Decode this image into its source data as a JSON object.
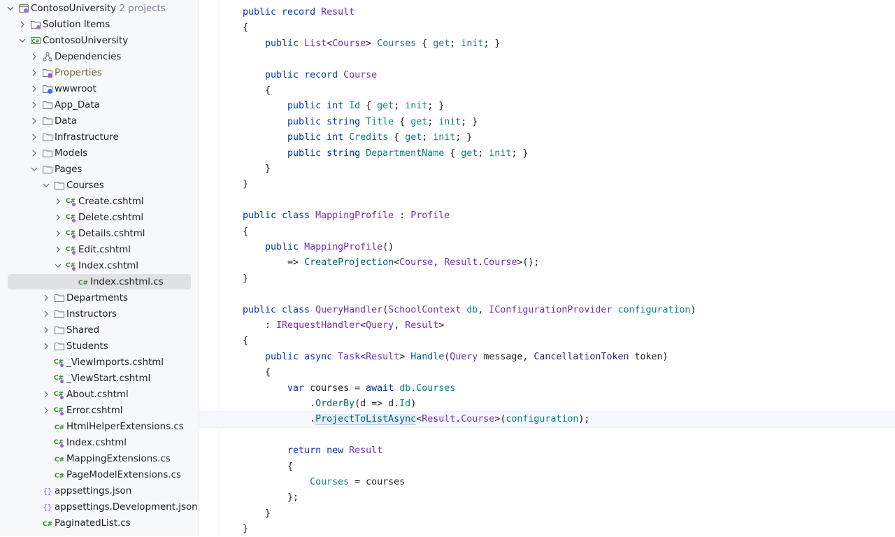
{
  "solution": {
    "name": "ContosoUniversity",
    "count": "· 2 projects"
  },
  "tree": [
    {
      "label": "Solution Items",
      "icon": "folder-solution-icon",
      "depth": 1,
      "expanded": false
    },
    {
      "label": "ContosoUniversity",
      "icon": "csharp-project-icon",
      "depth": 1,
      "expanded": true
    },
    {
      "label": "Dependencies",
      "icon": "dependencies-icon",
      "depth": 2,
      "expanded": false
    },
    {
      "label": "Properties",
      "icon": "properties-folder-icon",
      "depth": 2,
      "expanded": false,
      "style": "olive"
    },
    {
      "label": "wwwroot",
      "icon": "web-folder-icon",
      "depth": 2,
      "expanded": false
    },
    {
      "label": "App_Data",
      "icon": "folder-icon",
      "depth": 2,
      "expanded": false
    },
    {
      "label": "Data",
      "icon": "folder-icon",
      "depth": 2,
      "expanded": false
    },
    {
      "label": "Infrastructure",
      "icon": "folder-icon",
      "depth": 2,
      "expanded": false
    },
    {
      "label": "Models",
      "icon": "folder-icon",
      "depth": 2,
      "expanded": false
    },
    {
      "label": "Pages",
      "icon": "folder-icon",
      "depth": 2,
      "expanded": true
    },
    {
      "label": "Courses",
      "icon": "folder-icon",
      "depth": 3,
      "expanded": true
    },
    {
      "label": "Create.cshtml",
      "icon": "cshtml-icon",
      "depth": 4,
      "expanded": false
    },
    {
      "label": "Delete.cshtml",
      "icon": "cshtml-icon",
      "depth": 4,
      "expanded": false
    },
    {
      "label": "Details.cshtml",
      "icon": "cshtml-icon",
      "depth": 4,
      "expanded": false
    },
    {
      "label": "Edit.cshtml",
      "icon": "cshtml-icon",
      "depth": 4,
      "expanded": false
    },
    {
      "label": "Index.cshtml",
      "icon": "cshtml-icon",
      "depth": 4,
      "expanded": true
    },
    {
      "label": "Index.cshtml.cs",
      "icon": "csharp-file-icon",
      "depth": 5,
      "leaf": true,
      "selected": true
    },
    {
      "label": "Departments",
      "icon": "folder-icon",
      "depth": 3,
      "expanded": false
    },
    {
      "label": "Instructors",
      "icon": "folder-icon",
      "depth": 3,
      "expanded": false
    },
    {
      "label": "Shared",
      "icon": "folder-icon",
      "depth": 3,
      "expanded": false
    },
    {
      "label": "Students",
      "icon": "folder-icon",
      "depth": 3,
      "expanded": false
    },
    {
      "label": "_ViewImports.cshtml",
      "icon": "cshtml-icon",
      "depth": 3,
      "leaf": true
    },
    {
      "label": "_ViewStart.cshtml",
      "icon": "cshtml-icon",
      "depth": 3,
      "leaf": true
    },
    {
      "label": "About.cshtml",
      "icon": "cshtml-icon",
      "depth": 3,
      "expanded": false
    },
    {
      "label": "Error.cshtml",
      "icon": "cshtml-icon",
      "depth": 3,
      "expanded": false
    },
    {
      "label": "HtmlHelperExtensions.cs",
      "icon": "csharp-file-icon",
      "depth": 3,
      "leaf": true
    },
    {
      "label": "Index.cshtml",
      "icon": "cshtml-icon",
      "depth": 3,
      "leaf": true
    },
    {
      "label": "MappingExtensions.cs",
      "icon": "csharp-file-icon",
      "depth": 3,
      "leaf": true
    },
    {
      "label": "PageModelExtensions.cs",
      "icon": "csharp-file-icon",
      "depth": 3,
      "leaf": true
    },
    {
      "label": "appsettings.json",
      "icon": "json-icon",
      "depth": 2,
      "leaf": true
    },
    {
      "label": "appsettings.Development.json",
      "icon": "json-icon",
      "depth": 2,
      "leaf": true
    },
    {
      "label": "PaginatedList.cs",
      "icon": "csharp-file-icon",
      "depth": 2,
      "leaf": true
    }
  ],
  "code": [
    [
      [
        "kw",
        "public record "
      ],
      [
        "ty",
        "Result"
      ]
    ],
    [
      [
        "",
        "{"
      ]
    ],
    [
      [
        "",
        "    "
      ],
      [
        "kw",
        "public "
      ],
      [
        "ty",
        "List"
      ],
      [
        "",
        "<"
      ],
      [
        "ty",
        "Course"
      ],
      [
        "",
        "> "
      ],
      [
        "pr",
        "Courses"
      ],
      [
        "",
        " { "
      ],
      [
        "pr",
        "get"
      ],
      [
        "",
        "; "
      ],
      [
        "pr",
        "init"
      ],
      [
        "",
        "; }"
      ]
    ],
    [
      [
        "",
        ""
      ]
    ],
    [
      [
        "",
        "    "
      ],
      [
        "kw",
        "public record "
      ],
      [
        "ty",
        "Course"
      ]
    ],
    [
      [
        "",
        "    {"
      ]
    ],
    [
      [
        "",
        "        "
      ],
      [
        "kw",
        "public int "
      ],
      [
        "pr",
        "Id"
      ],
      [
        "",
        " { "
      ],
      [
        "pr",
        "get"
      ],
      [
        "",
        "; "
      ],
      [
        "pr",
        "init"
      ],
      [
        "",
        "; }"
      ]
    ],
    [
      [
        "",
        "        "
      ],
      [
        "kw",
        "public string "
      ],
      [
        "pr",
        "Title"
      ],
      [
        "",
        " { "
      ],
      [
        "pr",
        "get"
      ],
      [
        "",
        "; "
      ],
      [
        "pr",
        "init"
      ],
      [
        "",
        "; }"
      ]
    ],
    [
      [
        "",
        "        "
      ],
      [
        "kw",
        "public int "
      ],
      [
        "pr",
        "Credits"
      ],
      [
        "",
        " { "
      ],
      [
        "pr",
        "get"
      ],
      [
        "",
        "; "
      ],
      [
        "pr",
        "init"
      ],
      [
        "",
        "; }"
      ]
    ],
    [
      [
        "",
        "        "
      ],
      [
        "kw",
        "public string "
      ],
      [
        "pr",
        "DepartmentName"
      ],
      [
        "",
        " { "
      ],
      [
        "pr",
        "get"
      ],
      [
        "",
        "; "
      ],
      [
        "pr",
        "init"
      ],
      [
        "",
        "; }"
      ]
    ],
    [
      [
        "",
        "    }"
      ]
    ],
    [
      [
        "",
        "}"
      ]
    ],
    [
      [
        "",
        ""
      ]
    ],
    [
      [
        "kw",
        "public class "
      ],
      [
        "ty",
        "MappingProfile"
      ],
      [
        "",
        " : "
      ],
      [
        "ty",
        "Profile"
      ]
    ],
    [
      [
        "",
        "{"
      ]
    ],
    [
      [
        "",
        "    "
      ],
      [
        "kw",
        "public "
      ],
      [
        "ty",
        "MappingProfile"
      ],
      [
        "",
        "()"
      ]
    ],
    [
      [
        "",
        "        => "
      ],
      [
        "mt",
        "CreateProjection"
      ],
      [
        "",
        "<"
      ],
      [
        "ty",
        "Course"
      ],
      [
        "",
        ", "
      ],
      [
        "ty",
        "Result"
      ],
      [
        "",
        "."
      ],
      [
        "ty",
        "Course"
      ],
      [
        "",
        ">();"
      ]
    ],
    [
      [
        "",
        "}"
      ]
    ],
    [
      [
        "",
        ""
      ]
    ],
    [
      [
        "kw",
        "public class "
      ],
      [
        "ty",
        "QueryHandler"
      ],
      [
        "",
        "("
      ],
      [
        "ty",
        "SchoolContext"
      ],
      [
        "",
        " "
      ],
      [
        "pr",
        "db"
      ],
      [
        "",
        ", "
      ],
      [
        "ty",
        "IConfigurationProvider"
      ],
      [
        "",
        " "
      ],
      [
        "pr",
        "configuration"
      ],
      [
        "",
        ")"
      ]
    ],
    [
      [
        "",
        "    : "
      ],
      [
        "ty",
        "IRequestHandler"
      ],
      [
        "",
        "<"
      ],
      [
        "ty",
        "Query"
      ],
      [
        "",
        ", "
      ],
      [
        "ty",
        "Result"
      ],
      [
        "",
        ">"
      ]
    ],
    [
      [
        "",
        "{"
      ]
    ],
    [
      [
        "",
        "    "
      ],
      [
        "kw",
        "public async "
      ],
      [
        "ty",
        "Task"
      ],
      [
        "",
        "<"
      ],
      [
        "ty",
        "Result"
      ],
      [
        "",
        "> "
      ],
      [
        "mt",
        "Handle"
      ],
      [
        "",
        "("
      ],
      [
        "ty",
        "Query"
      ],
      [
        "",
        " message, "
      ],
      [
        "st",
        "CancellationToken"
      ],
      [
        "",
        " token)"
      ]
    ],
    [
      [
        "",
        "    {"
      ]
    ],
    [
      [
        "",
        "        "
      ],
      [
        "kw",
        "var "
      ],
      [
        "",
        "courses = "
      ],
      [
        "kw",
        "await "
      ],
      [
        "pr",
        "db"
      ],
      [
        "",
        "."
      ],
      [
        "pr",
        "Courses"
      ]
    ],
    [
      [
        "",
        "            ."
      ],
      [
        "mt",
        "OrderBy"
      ],
      [
        "",
        "(d => d."
      ],
      [
        "pr",
        "Id"
      ],
      [
        "",
        ")"
      ]
    ],
    [
      [
        "",
        "            ."
      ],
      [
        "mt hl",
        "ProjectToListAsync"
      ],
      [
        "",
        "<"
      ],
      [
        "ty",
        "Result"
      ],
      [
        "",
        "."
      ],
      [
        "ty",
        "Course"
      ],
      [
        "",
        ">("
      ],
      [
        "pr",
        "configuration"
      ],
      [
        "",
        ");"
      ]
    ],
    [
      [
        "",
        ""
      ]
    ],
    [
      [
        "",
        "        "
      ],
      [
        "kw",
        "return new "
      ],
      [
        "ty",
        "Result"
      ]
    ],
    [
      [
        "",
        "        {"
      ]
    ],
    [
      [
        "",
        "            "
      ],
      [
        "pr",
        "Courses"
      ],
      [
        "",
        " = courses"
      ]
    ],
    [
      [
        "",
        "        };"
      ]
    ],
    [
      [
        "",
        "    }"
      ]
    ],
    [
      [
        "",
        "}"
      ]
    ]
  ]
}
